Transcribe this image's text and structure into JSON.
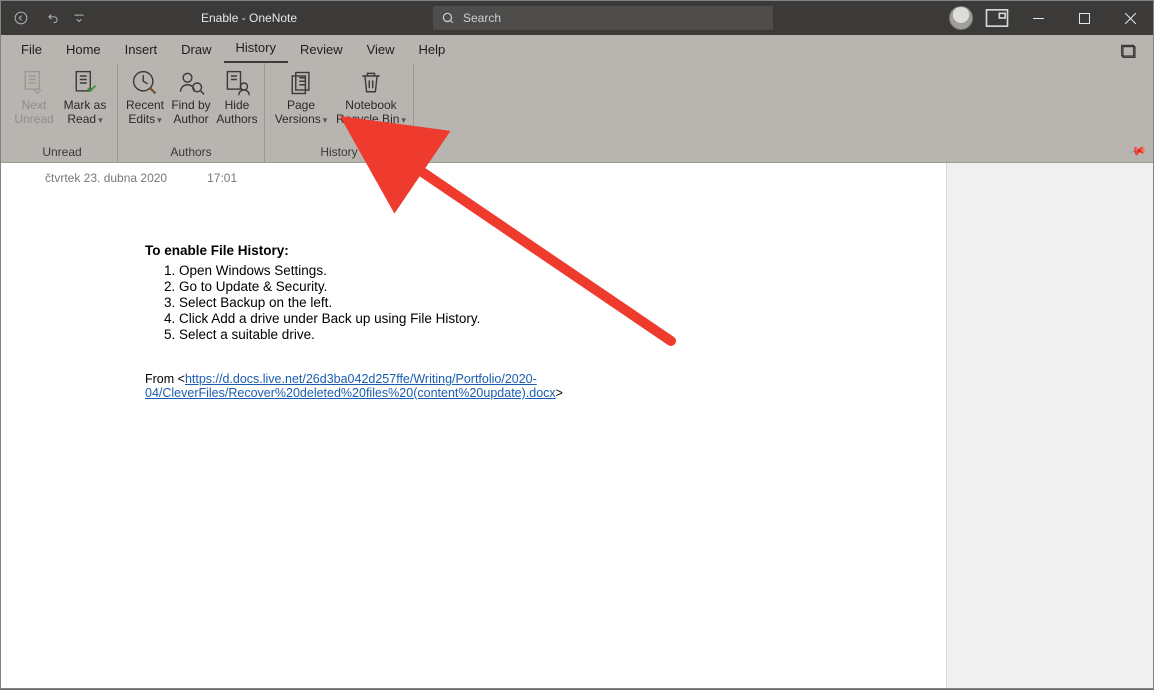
{
  "titlebar": {
    "doc_title": "Enable",
    "app_name": "OneNote",
    "full_title": "Enable  -  OneNote",
    "search_placeholder": "Search"
  },
  "menu": {
    "items": [
      "File",
      "Home",
      "Insert",
      "Draw",
      "History",
      "Review",
      "View",
      "Help"
    ],
    "active": "History"
  },
  "ribbon": {
    "group_unread": {
      "label": "Unread",
      "next_unread": "Next Unread",
      "mark_as_read": "Mark as Read"
    },
    "group_authors": {
      "label": "Authors",
      "recent_edits": "Recent Edits",
      "find_by_author": "Find by Author",
      "hide_authors": "Hide Authors"
    },
    "group_history": {
      "label": "History",
      "page_versions": "Page Versions",
      "notebook_recycle_bin": "Notebook Recycle Bin"
    }
  },
  "page": {
    "date": "čtvrtek 23. dubna 2020",
    "time": "17:01",
    "heading": "To enable File History:",
    "steps": [
      "Open Windows Settings.",
      "Go to Update & Security.",
      "Select Backup on the left.",
      "Click Add a drive under Back up using File History.",
      "Select a suitable drive."
    ],
    "from_prefix": "From <",
    "url": "https://d.docs.live.net/26d3ba042d257ffe/Writing/Portfolio/2020-04/CleverFiles/Recover%20deleted%20files%20(content%20update).docx",
    "from_suffix": ">"
  }
}
